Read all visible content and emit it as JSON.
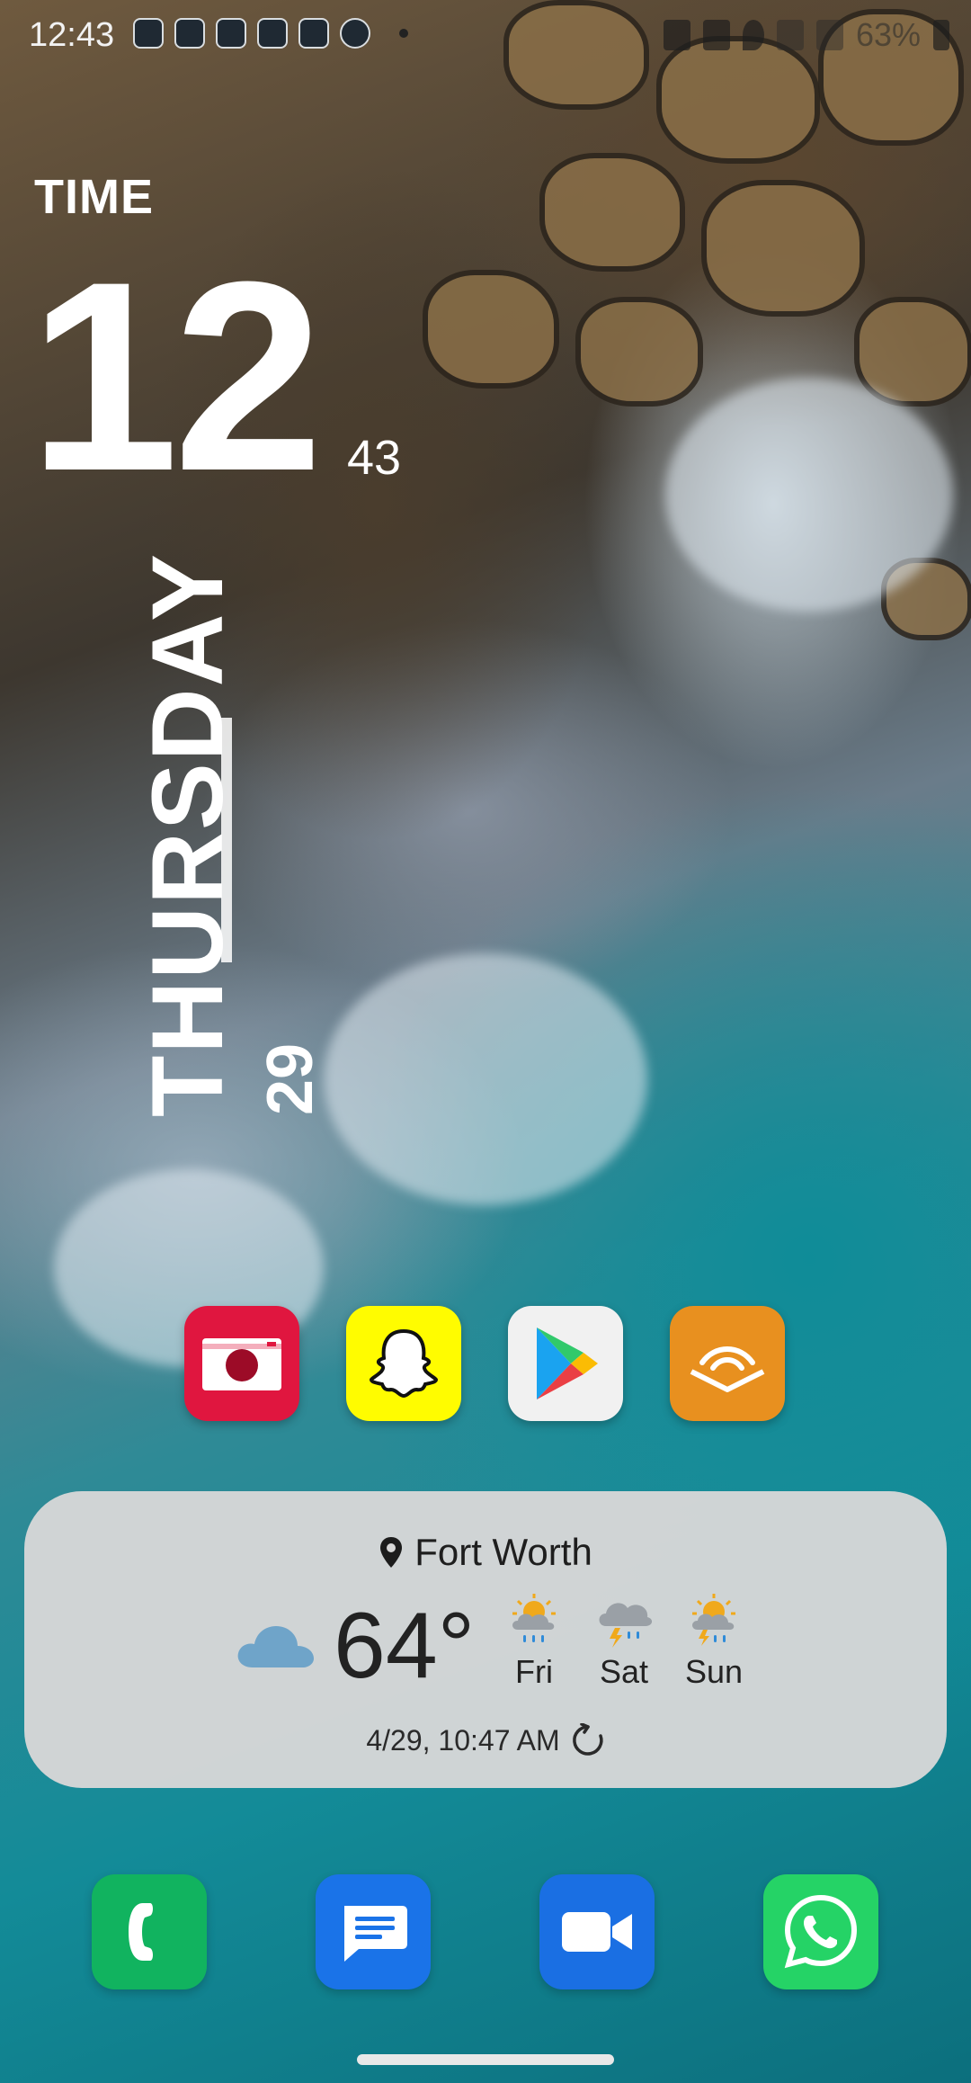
{
  "status_bar": {
    "time": "12:43",
    "battery": "63%"
  },
  "clock_widget": {
    "label": "TIME",
    "hour": "12",
    "minute": "43",
    "day": "THURSDAY",
    "date": "29"
  },
  "apps": [
    {
      "name": "camera-app",
      "icon": "camera-icon"
    },
    {
      "name": "snapchat-app",
      "icon": "ghost-icon"
    },
    {
      "name": "play-store-app",
      "icon": "play-icon"
    },
    {
      "name": "audible-app",
      "icon": "audible-icon"
    }
  ],
  "weather": {
    "location": "Fort Worth",
    "temperature": "64°",
    "current_icon": "cloud-icon",
    "forecast": [
      {
        "day": "Fri",
        "icon": "sun-rain-icon"
      },
      {
        "day": "Sat",
        "icon": "thunder-rain-icon"
      },
      {
        "day": "Sun",
        "icon": "sun-thunder-rain-icon"
      }
    ],
    "updated": "4/29, 10:47 AM"
  },
  "dock": [
    {
      "name": "phone-app",
      "icon": "phone-icon"
    },
    {
      "name": "messages-app",
      "icon": "message-icon"
    },
    {
      "name": "meet-app",
      "icon": "video-icon"
    },
    {
      "name": "whatsapp-app",
      "icon": "whatsapp-icon"
    }
  ],
  "colors": {
    "weather_card": "#d7d7d7",
    "cloud": "#6fa4c9",
    "camera": "#e0163f",
    "snapchat": "#fffc00",
    "audible": "#e8901f",
    "phone": "#11b35f",
    "messages": "#1a73e8",
    "whatsapp": "#25d366"
  }
}
